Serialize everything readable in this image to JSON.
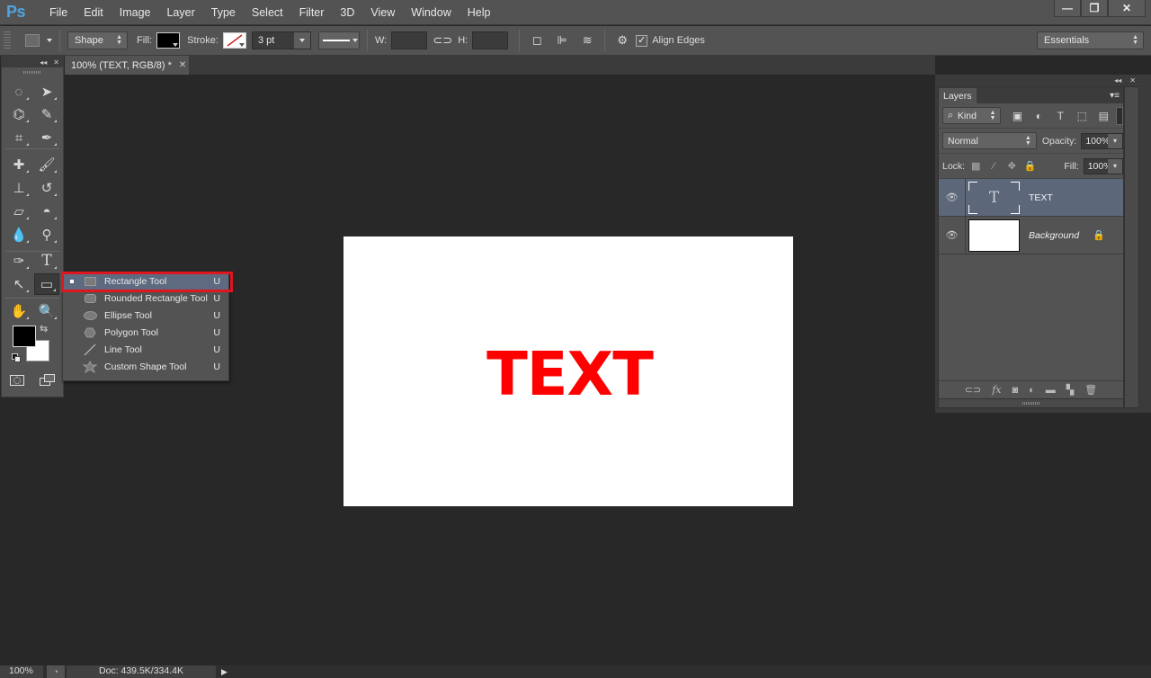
{
  "app": {
    "logo": "Ps"
  },
  "menu": [
    "File",
    "Edit",
    "Image",
    "Layer",
    "Type",
    "Select",
    "Filter",
    "3D",
    "View",
    "Window",
    "Help"
  ],
  "window_controls": {
    "minimize": "—",
    "restore": "❐",
    "close": "✕"
  },
  "options_bar": {
    "mode": "Shape",
    "fill_label": "Fill:",
    "fill_color": "#000000",
    "stroke_label": "Stroke:",
    "stroke_width": "3 pt",
    "w_label": "W:",
    "w_value": "",
    "h_label": "H:",
    "h_value": "",
    "align_edges_label": "Align Edges",
    "align_edges_checked": true,
    "workspace": "Essentials"
  },
  "document_tab": {
    "title": "100% (TEXT, RGB/8) *",
    "close": "✕"
  },
  "toolbox": {
    "collapse": "◂◂",
    "close": "✕",
    "foreground_color": "#000000",
    "background_color": "#ffffff",
    "tools": [
      {
        "name": "elliptical-marquee-tool",
        "glyph": "◌"
      },
      {
        "name": "move-tool",
        "glyph": "➤"
      },
      {
        "name": "polygonal-lasso-tool",
        "glyph": "⌬"
      },
      {
        "name": "quick-selection-tool",
        "glyph": "✎"
      },
      {
        "name": "crop-tool",
        "glyph": "⌗"
      },
      {
        "name": "eyedropper-tool",
        "glyph": "✒"
      },
      {
        "name": "spot-healing-brush-tool",
        "glyph": "✚"
      },
      {
        "name": "brush-tool",
        "glyph": "🖌"
      },
      {
        "name": "clone-stamp-tool",
        "glyph": "⊥"
      },
      {
        "name": "history-brush-tool",
        "glyph": "↺"
      },
      {
        "name": "eraser-tool",
        "glyph": "▱"
      },
      {
        "name": "paint-bucket-tool",
        "glyph": "◓"
      },
      {
        "name": "blur-tool",
        "glyph": "💧"
      },
      {
        "name": "dodge-tool",
        "glyph": "⚲"
      },
      {
        "name": "pen-tool",
        "glyph": "✑"
      },
      {
        "name": "type-tool",
        "glyph": "T"
      },
      {
        "name": "path-selection-tool",
        "glyph": "↖"
      },
      {
        "name": "rectangle-tool",
        "glyph": "▭"
      },
      {
        "name": "hand-tool",
        "glyph": "✋"
      },
      {
        "name": "zoom-tool",
        "glyph": "🔍"
      }
    ]
  },
  "shape_flyout": {
    "items": [
      {
        "label": "Rectangle Tool",
        "shortcut": "U",
        "selected": true
      },
      {
        "label": "Rounded Rectangle Tool",
        "shortcut": "U",
        "selected": false
      },
      {
        "label": "Ellipse Tool",
        "shortcut": "U",
        "selected": false
      },
      {
        "label": "Polygon Tool",
        "shortcut": "U",
        "selected": false
      },
      {
        "label": "Line Tool",
        "shortcut": "U",
        "selected": false
      },
      {
        "label": "Custom Shape Tool",
        "shortcut": "U",
        "selected": false
      }
    ],
    "highlight_color": "#e0161e"
  },
  "canvas": {
    "text": "TEXT",
    "text_color": "#ff0000",
    "background": "#ffffff"
  },
  "layers_panel": {
    "tab": "Layers",
    "filter": "Kind",
    "blend_mode": "Normal",
    "opacity_label": "Opacity:",
    "opacity": "100%",
    "lock_label": "Lock:",
    "fill_label": "Fill:",
    "fill": "100%",
    "layers": [
      {
        "name": "TEXT",
        "type": "text",
        "visible": true,
        "selected": true,
        "locked": false
      },
      {
        "name": "Background",
        "type": "background",
        "visible": true,
        "selected": false,
        "locked": true
      }
    ]
  },
  "status_bar": {
    "zoom": "100%",
    "doc_info": "Doc: 439.5K/334.4K"
  }
}
